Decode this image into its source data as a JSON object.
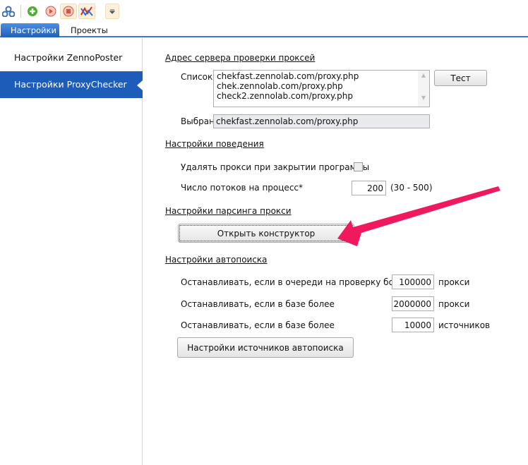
{
  "toolbar": {
    "icons": [
      "network-icon",
      "add-icon",
      "play-icon",
      "stop-icon",
      "chart-icon",
      "dropdown-icon"
    ]
  },
  "tabs": [
    {
      "label": "Настройки",
      "active": true
    },
    {
      "label": "Проекты",
      "active": false
    }
  ],
  "sidebar": {
    "items": [
      {
        "label": "Настройки ZennoPoster",
        "active": false
      },
      {
        "label": "Настройки ProxyChecker",
        "active": true
      }
    ]
  },
  "server": {
    "heading": "Адрес сервера проверки проксей",
    "list_label": "Список",
    "list": [
      "chekfast.zennolab.com/proxy.php",
      "chek.zennolab.com/proxy.php",
      "check2.zennolab.com/proxy.php"
    ],
    "test_button": "Тест",
    "selected_label": "Выбран",
    "selected_value": "chekfast.zennolab.com/proxy.php"
  },
  "behavior": {
    "heading": "Настройки поведения",
    "delete_label": "Удалять прокси при закрытии программы",
    "delete_checked": false,
    "threads_label": "Число потоков на процесс*",
    "threads_value": "200",
    "threads_range": "(30 - 500)"
  },
  "parsing": {
    "heading": "Настройки парсинга прокси",
    "open_button": "Открыть конструктор"
  },
  "autosearch": {
    "heading": "Настройки автопоиска",
    "rows": [
      {
        "label": "Останавливать, если в очереди на проверку более",
        "value": "100000",
        "unit": "прокси"
      },
      {
        "label": "Останавливать, если в базе более",
        "value": "2000000",
        "unit": "прокси"
      },
      {
        "label": "Останавливать, если в базе более",
        "value": "10000",
        "unit": "источников"
      }
    ],
    "sources_button": "Настройки источников автопоиска"
  },
  "annotation": {
    "arrow_color": "#f0195e"
  }
}
